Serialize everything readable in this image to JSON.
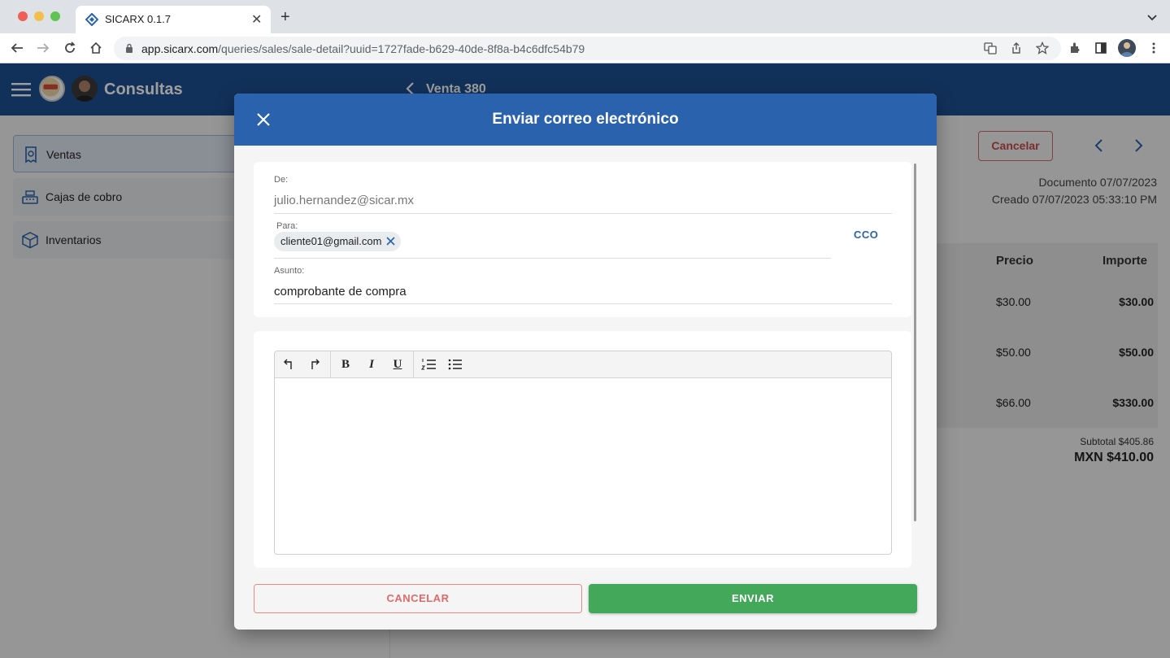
{
  "browser": {
    "tab_title": "SICARX 0.1.7",
    "url_host": "app.sicarx.com",
    "url_path": "/queries/sales/sale-detail?uuid=1727fade-b629-40de-8f8a-b4c6dfc54b79"
  },
  "app": {
    "title": "Consultas",
    "sale_title": "Venta 380",
    "accent_color": "#1e4f92"
  },
  "sidebar": {
    "items": [
      {
        "label": "Ventas",
        "icon": "receipt-icon"
      },
      {
        "label": "Cajas de cobro",
        "icon": "cash-register-icon"
      },
      {
        "label": "Inventarios",
        "icon": "box-icon"
      }
    ]
  },
  "detail": {
    "cancel_label": "Cancelar",
    "documento": "Documento 07/07/2023",
    "creado": "Creado 07/07/2023 05:33:10 PM",
    "columns": [
      "Precio",
      "Importe"
    ],
    "rows": [
      {
        "precio": "$30.00",
        "importe": "$30.00"
      },
      {
        "precio": "$50.00",
        "importe": "$50.00"
      },
      {
        "precio": "$66.00",
        "importe": "$330.00"
      }
    ],
    "subtotal": "Subtotal $405.86",
    "total": "MXN $410.00"
  },
  "modal": {
    "title": "Enviar correo electrónico",
    "from_label": "De:",
    "from_value": "julio.hernandez@sicar.mx",
    "to_label": "Para:",
    "to_chips": [
      "cliente01@gmail.com"
    ],
    "cco_label": "CCO",
    "subject_label": "Asunto:",
    "subject_value": "comprobante de compra",
    "toolbar": {
      "bold": "B",
      "italic": "I",
      "underline": "U"
    },
    "cancel_button": "CANCELAR",
    "send_button": "ENVIAR",
    "send_color": "#43a85a",
    "cancel_color": "#e06a6a"
  }
}
